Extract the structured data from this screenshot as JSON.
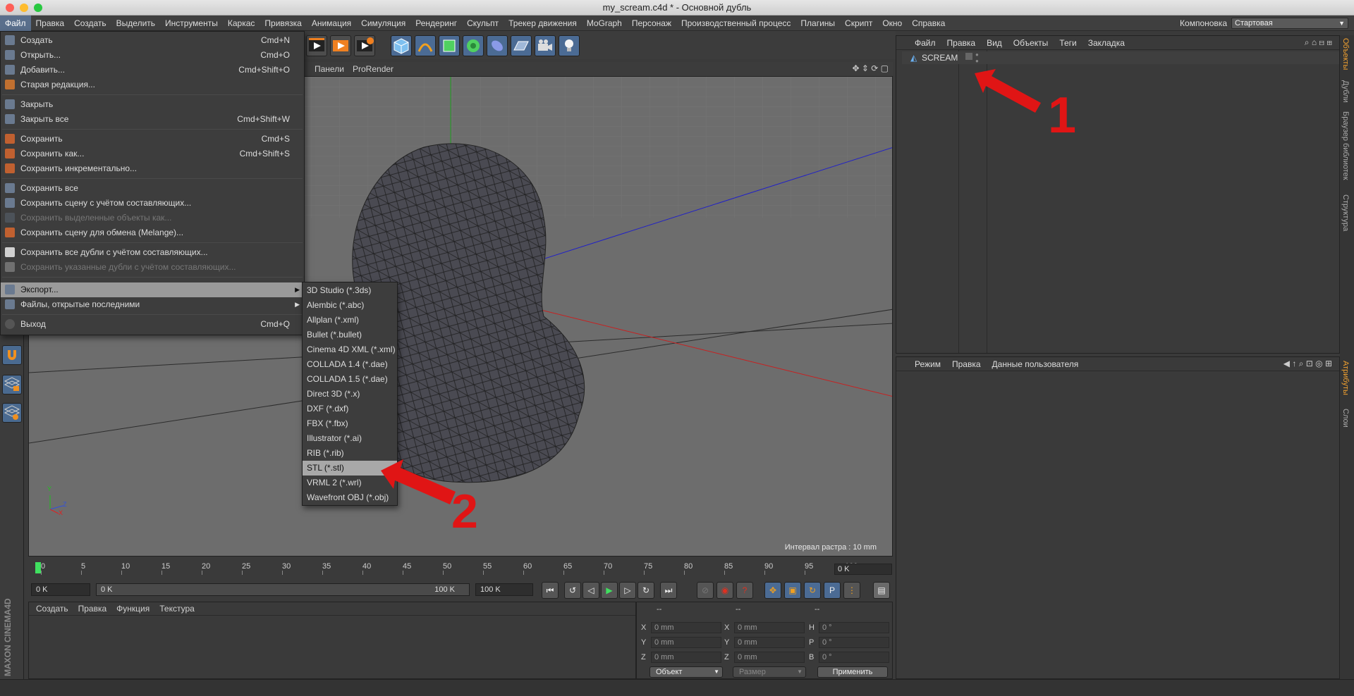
{
  "window": {
    "title": "my_scream.c4d * - Основной дубль"
  },
  "menubar": {
    "items": [
      "Файл",
      "Правка",
      "Создать",
      "Выделить",
      "Инструменты",
      "Каркас",
      "Привязка",
      "Анимация",
      "Симуляция",
      "Рендеринг",
      "Скульпт",
      "Трекер движения",
      "MoGraph",
      "Персонаж",
      "Производственный процесс",
      "Плагины",
      "Скрипт",
      "Окно",
      "Справка"
    ],
    "layout_label": "Компоновка",
    "layout_value": "Стартовая"
  },
  "file_menu": {
    "items": [
      {
        "label": "Создать",
        "shortcut": "Cmd+N"
      },
      {
        "label": "Открыть...",
        "shortcut": "Cmd+O"
      },
      {
        "label": "Добавить...",
        "shortcut": "Cmd+Shift+O"
      },
      {
        "label": "Старая редакция...",
        "shortcut": ""
      },
      {
        "label": "Закрыть",
        "shortcut": ""
      },
      {
        "label": "Закрыть все",
        "shortcut": "Cmd+Shift+W"
      },
      {
        "label": "Сохранить",
        "shortcut": "Cmd+S"
      },
      {
        "label": "Сохранить как...",
        "shortcut": "Cmd+Shift+S"
      },
      {
        "label": "Сохранить инкрементально...",
        "shortcut": ""
      },
      {
        "label": "Сохранить все",
        "shortcut": ""
      },
      {
        "label": "Сохранить сцену с учётом составляющих...",
        "shortcut": ""
      },
      {
        "label": "Сохранить выделенные объекты как...",
        "shortcut": ""
      },
      {
        "label": "Сохранить сцену для обмена (Melange)...",
        "shortcut": ""
      },
      {
        "label": "Сохранить все дубли с учётом составляющих...",
        "shortcut": ""
      },
      {
        "label": "Сохранить указанные дубли с учётом составляющих...",
        "shortcut": ""
      },
      {
        "label": "Экспорт...",
        "shortcut": ""
      },
      {
        "label": "Файлы, открытые последними",
        "shortcut": ""
      },
      {
        "label": "Выход",
        "shortcut": "Cmd+Q"
      }
    ]
  },
  "export_menu": {
    "items": [
      "3D Studio (*.3ds)",
      "Alembic (*.abc)",
      "Allplan (*.xml)",
      "Bullet (*.bullet)",
      "Cinema 4D XML (*.xml)",
      "COLLADA 1.4 (*.dae)",
      "COLLADA 1.5 (*.dae)",
      "Direct 3D (*.x)",
      "DXF (*.dxf)",
      "FBX (*.fbx)",
      "Illustrator (*.ai)",
      "RIB (*.rib)",
      "STL (*.stl)",
      "VRML 2 (*.wrl)",
      "Wavefront OBJ (*.obj)"
    ],
    "highlighted": "STL (*.stl)"
  },
  "viewport": {
    "menu": [
      "Панели",
      "ProRender"
    ],
    "raster_info": "Интервал растра : 10 mm",
    "axis_labels": {
      "y": "Y",
      "z": "Z",
      "x": "X"
    }
  },
  "timeline": {
    "ticks": [
      "0",
      "5",
      "10",
      "15",
      "20",
      "25",
      "30",
      "35",
      "40",
      "45",
      "50",
      "55",
      "60",
      "65",
      "70",
      "75",
      "80",
      "85",
      "90",
      "95",
      "100"
    ],
    "end_field": "0 K"
  },
  "transport": {
    "start_field": "0 K",
    "slider_start": "0 K",
    "slider_end": "100 K",
    "end_field": "100 K"
  },
  "material_panel": {
    "menu": [
      "Создать",
      "Правка",
      "Функция",
      "Текстура"
    ]
  },
  "branding": {
    "text": "MAXON CINEMA4D"
  },
  "coords_panel": {
    "headers": [
      "--",
      "--",
      "--"
    ],
    "rows": [
      {
        "a": "X",
        "av": "0 mm",
        "b": "X",
        "bv": "0 mm",
        "c": "H",
        "cv": "0 °"
      },
      {
        "a": "Y",
        "av": "0 mm",
        "b": "Y",
        "bv": "0 mm",
        "c": "P",
        "cv": "0 °"
      },
      {
        "a": "Z",
        "av": "0 mm",
        "b": "Z",
        "bv": "0 mm",
        "c": "B",
        "cv": "0 °"
      }
    ],
    "mode": "Объект",
    "size": "Размер",
    "apply": "Применить"
  },
  "objects_panel": {
    "menu": [
      "Файл",
      "Правка",
      "Вид",
      "Объекты",
      "Теги",
      "Закладка"
    ],
    "object_name": "SCREAM"
  },
  "attributes_panel": {
    "menu": [
      "Режим",
      "Правка",
      "Данные пользователя"
    ]
  },
  "right_tabs": [
    "Объекты",
    "Дубли",
    "Браузер библиотек",
    "Структура",
    "Атрибуты",
    "Слои"
  ],
  "annotations": {
    "one": "1",
    "two": "2"
  },
  "colors": {
    "accent": "#5a6f8c",
    "annotation": "#e01515",
    "highlight": "#a8a8a8"
  }
}
